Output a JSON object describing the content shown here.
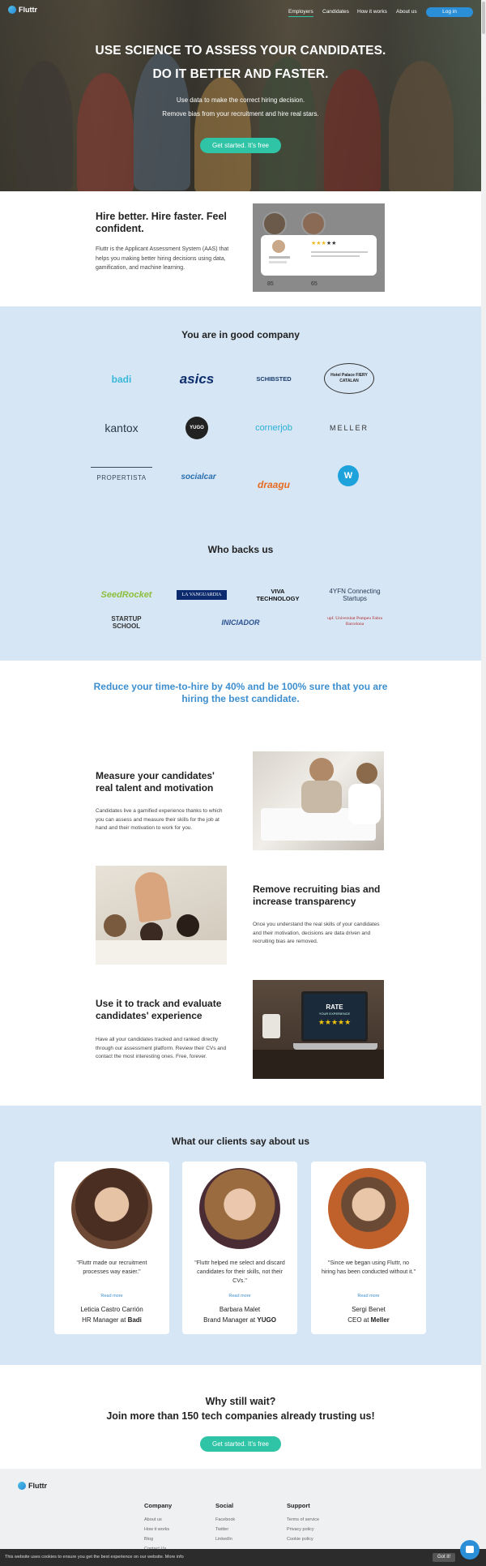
{
  "nav": {
    "brand": "Fluttr",
    "links": [
      "Employers",
      "Candidates",
      "How it works",
      "About us"
    ],
    "login": "Log in"
  },
  "hero": {
    "title_line1": "USE SCIENCE TO ASSESS YOUR CANDIDATES.",
    "title_line2": "DO IT BETTER AND FASTER.",
    "sub_line1": "Use data to make the correct hiring decision.",
    "sub_line2": "Remove bias from your recruitment and hire real stars.",
    "cta": "Get started. It's free"
  },
  "intro": {
    "title": "Hire better. Hire faster. Feel confident.",
    "text": "Fluttr is the Applicant Assessment System (AAS) that helps you making better hiring decisions using data, gamification, and machine learning.",
    "stat1": "85",
    "stat2": "65"
  },
  "company": {
    "title": "You are in good company",
    "logos": [
      "badi",
      "asics",
      "SCHIBSTED",
      "Hotel Palace FIERY CATALAN",
      "kantox",
      "YUGO",
      "cornerjob",
      "MELLER",
      "PROPERTISTA",
      "socialcar",
      "draagu",
      "W"
    ]
  },
  "backers": {
    "title": "Who backs us",
    "logos": [
      "SeedRocket",
      "LA VANGUARDIA",
      "VIVA TECHNOLOGY",
      "4YFN Connecting Startups",
      "STARTUP SCHOOL",
      "INICIADOR",
      "upf. Universitat Pompeu Fabra Barcelona"
    ]
  },
  "tagline": "Reduce your time-to-hire by 40% and be 100% sure that you are hiring the best candidate.",
  "features": [
    {
      "title": "Measure your candidates' real talent and motivation",
      "text": "Candidates live a gamified experience thanks to which you can assess and measure their skills for the job at hand and their motivation to work for you."
    },
    {
      "title": "Remove recruiting bias and increase transparency",
      "text": "Once you understand the real skills of your candidates and their motivation, decisions are data driven and recruiting bias are removed."
    },
    {
      "title": "Use it to track and evaluate candidates' experience",
      "text": "Have all your candidates tracked and ranked directly through our assessment platform. Review their CVs and contact the most interesting ones. Free, forever."
    }
  ],
  "laptop": {
    "rate": "RATE",
    "sub": "YOUR EXPERIENCE"
  },
  "testimonials": {
    "title": "What our clients say about us",
    "items": [
      {
        "quote": "\"Fluttr made our recruitment processes way easier.\"",
        "more": "Read more",
        "name": "Leticia Castro Carrión",
        "role": "HR Manager at",
        "company": "Badi"
      },
      {
        "quote": "\"Fluttr helped me select and discard candidates for their skills, not their CVs.\"",
        "more": "Read more",
        "name": "Barbara Malet",
        "role": "Brand Manager at",
        "company": "YUGO"
      },
      {
        "quote": "\"Since we began using Fluttr, no hiring has been conducted without it.\"",
        "more": "Read more",
        "name": "Sergi Benet",
        "role": "CEO at",
        "company": "Meller"
      }
    ]
  },
  "closing": {
    "line1": "Why still wait?",
    "line2": "Join more than 150 tech companies already trusting us!",
    "cta": "Get started. It's free"
  },
  "footer": {
    "brand": "Fluttr",
    "columns": [
      {
        "title": "Company",
        "links": [
          "About us",
          "How it works",
          "Blog",
          "Contact Us"
        ]
      },
      {
        "title": "Social",
        "links": [
          "Facebook",
          "Twitter",
          "LinkedIn"
        ]
      },
      {
        "title": "Support",
        "links": [
          "Terms of service",
          "Privacy policy",
          "Cookie policy"
        ]
      }
    ]
  },
  "cookie": {
    "text": "This website uses cookies to ensure you get the best experience on our website. More info",
    "button": "Got it!"
  },
  "colors": {
    "accent": "#2ec4a5",
    "primary": "#2b8fd8",
    "band": "#d6e6f5",
    "tagline": "#3d8fd0"
  }
}
